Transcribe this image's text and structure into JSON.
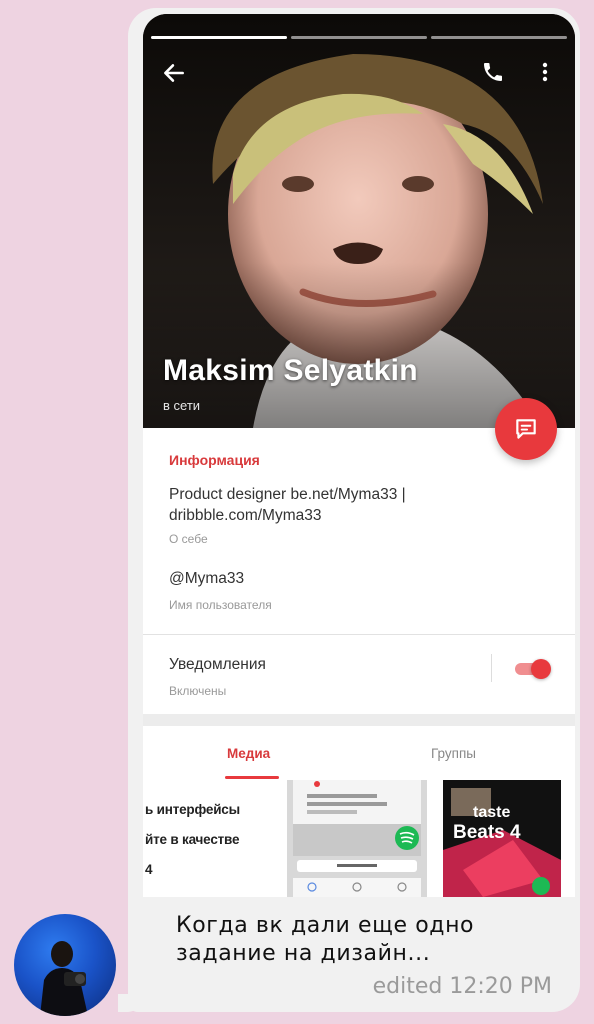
{
  "profile": {
    "name": "Maksim Selyatkin",
    "status": "в сети"
  },
  "info": {
    "section_title": "Информация",
    "bio": "Product designer be.net/Myma33 | dribbble.com/Myma33",
    "bio_caption": "О себе",
    "username": "@Myma33",
    "username_caption": "Имя пользователя",
    "notifications_label": "Уведомления",
    "notifications_state": "Включены",
    "notifications_on": true
  },
  "tabs": {
    "media": "Медиа",
    "groups": "Группы"
  },
  "media": {
    "thumb1_lines": [
      "ь интерфейсы",
      "йте в качестве",
      "4"
    ],
    "thumb3_text": "Beats 4",
    "thumb3_mirror": "taste"
  },
  "message": {
    "text": "Когда вк дали еще одно задание на дизайн...",
    "time": "edited 12:20 PM"
  },
  "colors": {
    "accent": "#e8393d",
    "background": "#eed3e1",
    "bubble": "#f1f1f1"
  },
  "icons": [
    "back-arrow-icon",
    "phone-icon",
    "more-vertical-icon",
    "message-icon"
  ]
}
